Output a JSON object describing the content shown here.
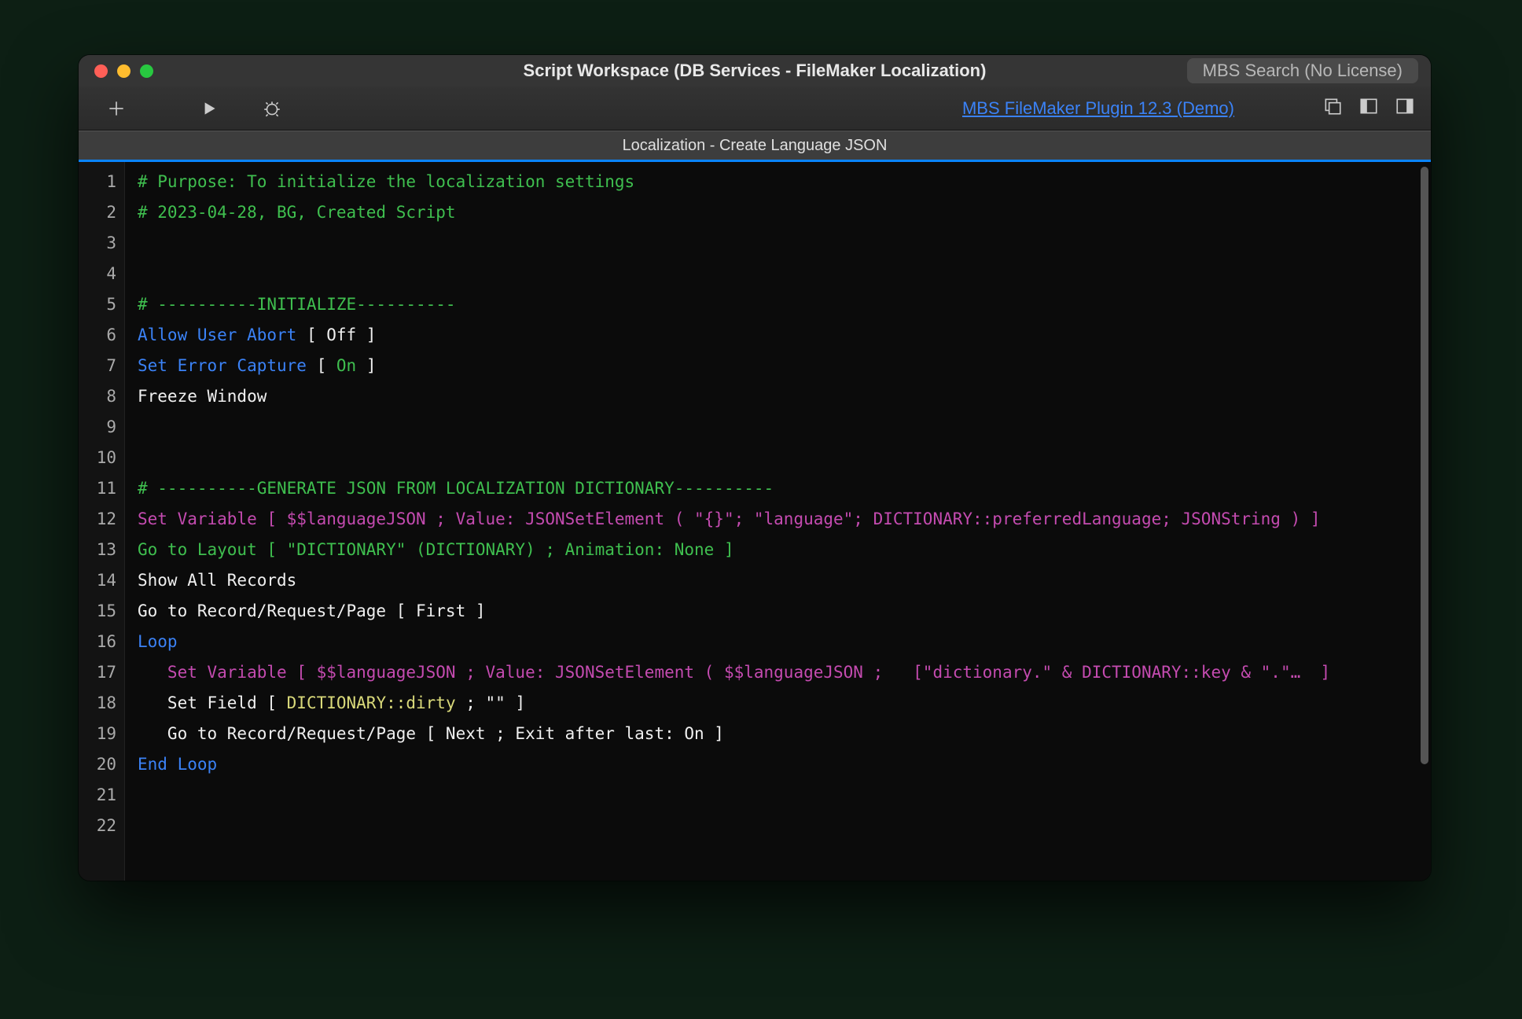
{
  "window": {
    "title": "Script Workspace (DB Services - FileMaker Localization)",
    "search_placeholder": "MBS Search (No License)",
    "plugin_link": "MBS FileMaker Plugin 12.3 (Demo)"
  },
  "tab": {
    "label": "Localization - Create Language JSON"
  },
  "script": {
    "lines": [
      {
        "n": 1,
        "segs": [
          {
            "cls": "c-comment",
            "t": "# Purpose: To initialize the localization settings"
          }
        ]
      },
      {
        "n": 2,
        "segs": [
          {
            "cls": "c-comment",
            "t": "# 2023-04-28, BG, Created Script"
          }
        ]
      },
      {
        "n": 3,
        "segs": []
      },
      {
        "n": 4,
        "segs": []
      },
      {
        "n": 5,
        "segs": [
          {
            "cls": "c-comment",
            "t": "# ----------INITIALIZE----------"
          }
        ]
      },
      {
        "n": 6,
        "segs": [
          {
            "cls": "c-blue",
            "t": "Allow User Abort "
          },
          {
            "cls": "c-white",
            "t": "[ Off ]"
          }
        ]
      },
      {
        "n": 7,
        "segs": [
          {
            "cls": "c-blue",
            "t": "Set Error Capture "
          },
          {
            "cls": "c-white",
            "t": "[ "
          },
          {
            "cls": "c-green",
            "t": "On"
          },
          {
            "cls": "c-white",
            "t": " ]"
          }
        ]
      },
      {
        "n": 8,
        "segs": [
          {
            "cls": "c-white",
            "t": "Freeze Window"
          }
        ]
      },
      {
        "n": 9,
        "segs": []
      },
      {
        "n": 10,
        "segs": []
      },
      {
        "n": 11,
        "segs": [
          {
            "cls": "c-comment",
            "t": "# ----------GENERATE JSON FROM LOCALIZATION DICTIONARY----------"
          }
        ]
      },
      {
        "n": 12,
        "segs": [
          {
            "cls": "c-purple",
            "t": "Set Variable [ $$languageJSON ; Value: JSONSetElement ( \"{}\"; \"language\"; DICTIONARY::preferredLanguage; JSONString ) ]"
          }
        ]
      },
      {
        "n": 13,
        "segs": [
          {
            "cls": "c-green",
            "t": "Go to Layout [ \"DICTIONARY\" (DICTIONARY) ; Animation: None ]"
          }
        ]
      },
      {
        "n": 14,
        "segs": [
          {
            "cls": "c-white",
            "t": "Show All Records"
          }
        ]
      },
      {
        "n": 15,
        "segs": [
          {
            "cls": "c-white",
            "t": "Go to Record/Request/Page [ First ]"
          }
        ]
      },
      {
        "n": 16,
        "segs": [
          {
            "cls": "c-blue",
            "t": "Loop"
          }
        ]
      },
      {
        "n": 17,
        "segs": [
          {
            "cls": "c-purple",
            "t": "   Set Variable [ $$languageJSON ; Value: JSONSetElement ( $$languageJSON ;   [\"dictionary.\" & DICTIONARY::key & \".\"…  ]"
          }
        ]
      },
      {
        "n": 18,
        "segs": [
          {
            "cls": "c-white",
            "t": "   Set Field [ "
          },
          {
            "cls": "c-yellow",
            "t": "DICTIONARY::dirty"
          },
          {
            "cls": "c-white",
            "t": " ; \"\" ]"
          }
        ]
      },
      {
        "n": 19,
        "segs": [
          {
            "cls": "c-white",
            "t": "   Go to Record/Request/Page [ Next ; Exit after last: On ]"
          }
        ]
      },
      {
        "n": 20,
        "segs": [
          {
            "cls": "c-blue",
            "t": "End Loop"
          }
        ]
      },
      {
        "n": 21,
        "segs": []
      },
      {
        "n": 22,
        "segs": []
      }
    ]
  }
}
